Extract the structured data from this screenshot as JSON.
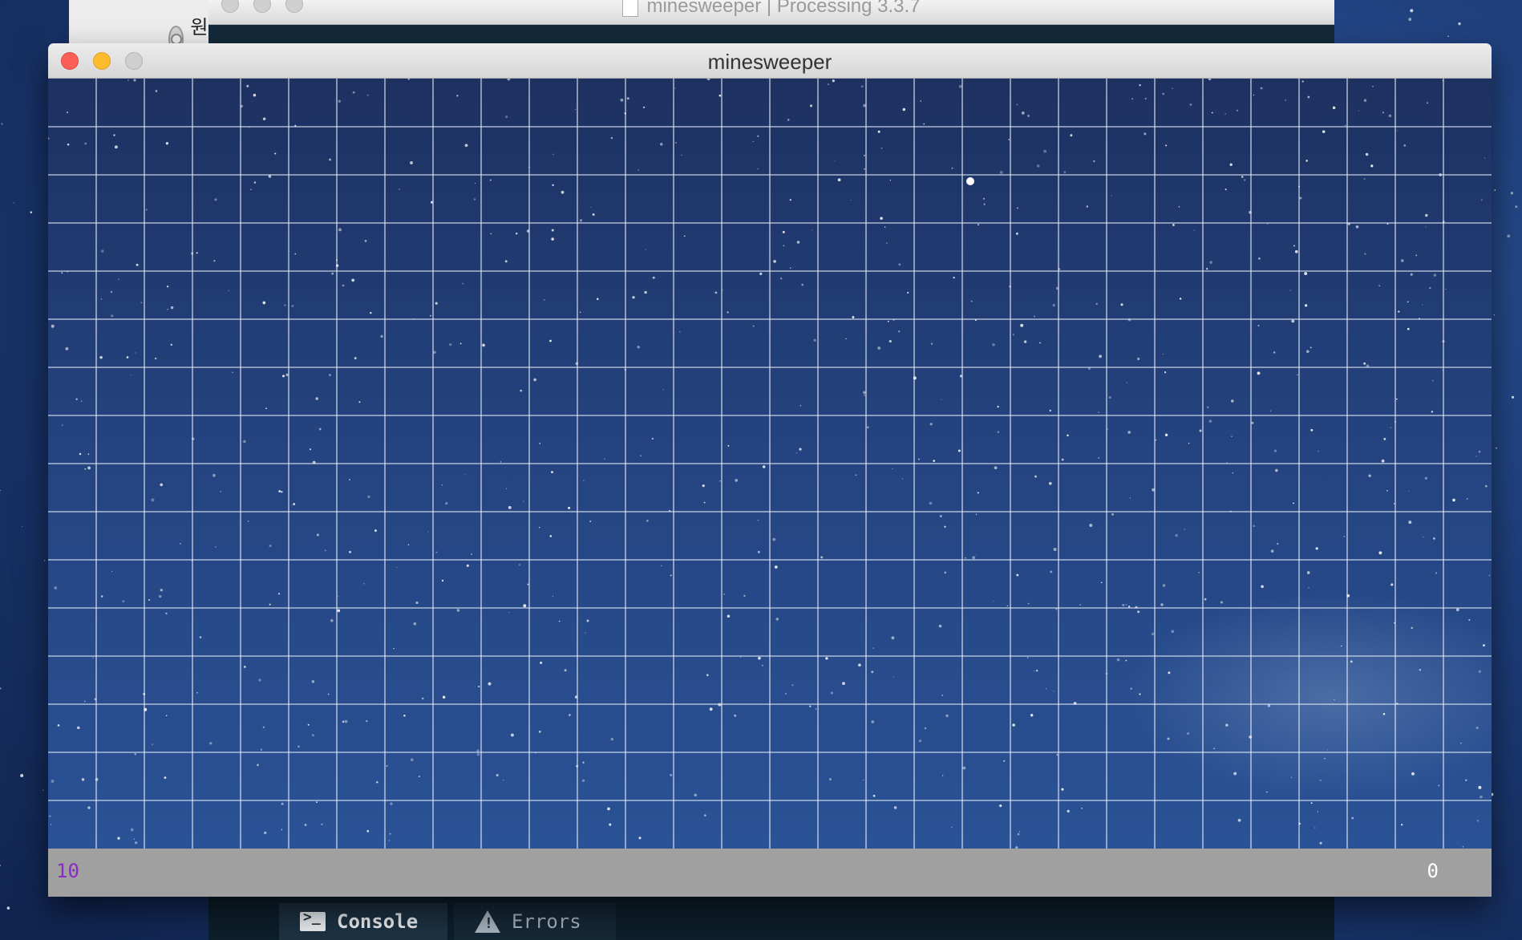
{
  "background_finder": {
    "item_label": "원격 디스",
    "item_icon": "disk-icon"
  },
  "background_ide": {
    "title": "minesweeper | Processing 3.3.7",
    "tabs": [
      {
        "label": "Console",
        "icon": "console-icon"
      },
      {
        "label": "Errors",
        "icon": "warning-icon"
      }
    ]
  },
  "sketch_window": {
    "title": "minesweeper",
    "grid": {
      "columns": 30,
      "rows": 16
    },
    "status": {
      "mines_remaining": "10",
      "score": "0"
    },
    "colors": {
      "grid_line": "#e6ecf5",
      "status_bar": "#a0a0a0",
      "mines_text": "#8a2cc4",
      "score_text": "#ffffff"
    }
  }
}
